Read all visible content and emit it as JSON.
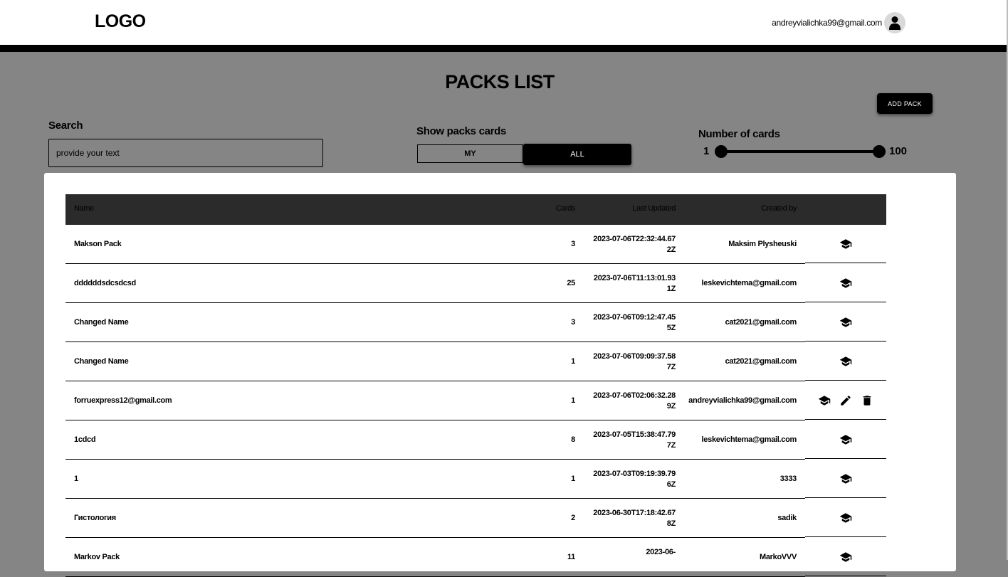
{
  "header": {
    "logo": "LOGO",
    "user_email": "andreyvialichka99@gmail.com"
  },
  "page": {
    "title": "PACKS LIST",
    "add_pack_label": "ADD PACK"
  },
  "filters": {
    "search_label": "Search",
    "search_placeholder": "provide your text",
    "show_label": "Show packs cards",
    "my_label": "MY",
    "all_label": "ALL",
    "selected": "ALL",
    "number_label": "Number of cards",
    "range_min": "1",
    "range_max": "100"
  },
  "table": {
    "columns": [
      "Name",
      "Cards",
      "Last Updated",
      "Created by"
    ],
    "rows": [
      {
        "name": "Makson Pack",
        "cards": "3",
        "updated": "2023-07-06T22:32:44.672Z",
        "created_by": "Maksim Plysheuski",
        "own": false
      },
      {
        "name": "ddddddsdcsdcsd",
        "cards": "25",
        "updated": "2023-07-06T11:13:01.931Z",
        "created_by": "leskevichtema@gmail.com",
        "own": false
      },
      {
        "name": "Changed Name",
        "cards": "3",
        "updated": "2023-07-06T09:12:47.455Z",
        "created_by": "cat2021@gmail.com",
        "own": false
      },
      {
        "name": "Changed Name",
        "cards": "1",
        "updated": "2023-07-06T09:09:37.587Z",
        "created_by": "cat2021@gmail.com",
        "own": false
      },
      {
        "name": "forruexpress12@gmail.com",
        "cards": "1",
        "updated": "2023-07-06T02:06:32.289Z",
        "created_by": "andreyvialichka99@gmail.com",
        "own": true
      },
      {
        "name": "1cdcd",
        "cards": "8",
        "updated": "2023-07-05T15:38:47.797Z",
        "created_by": "leskevichtema@gmail.com",
        "own": false
      },
      {
        "name": "1",
        "cards": "1",
        "updated": "2023-07-03T09:19:39.796Z",
        "created_by": "3333",
        "own": false
      },
      {
        "name": "Гистология",
        "cards": "2",
        "updated": "2023-06-30T17:18:42.678Z",
        "created_by": "sadik",
        "own": false
      },
      {
        "name": "Markov Pack",
        "cards": "11",
        "updated": "2023-06-",
        "created_by": "MarkoVVV",
        "own": false
      }
    ]
  }
}
